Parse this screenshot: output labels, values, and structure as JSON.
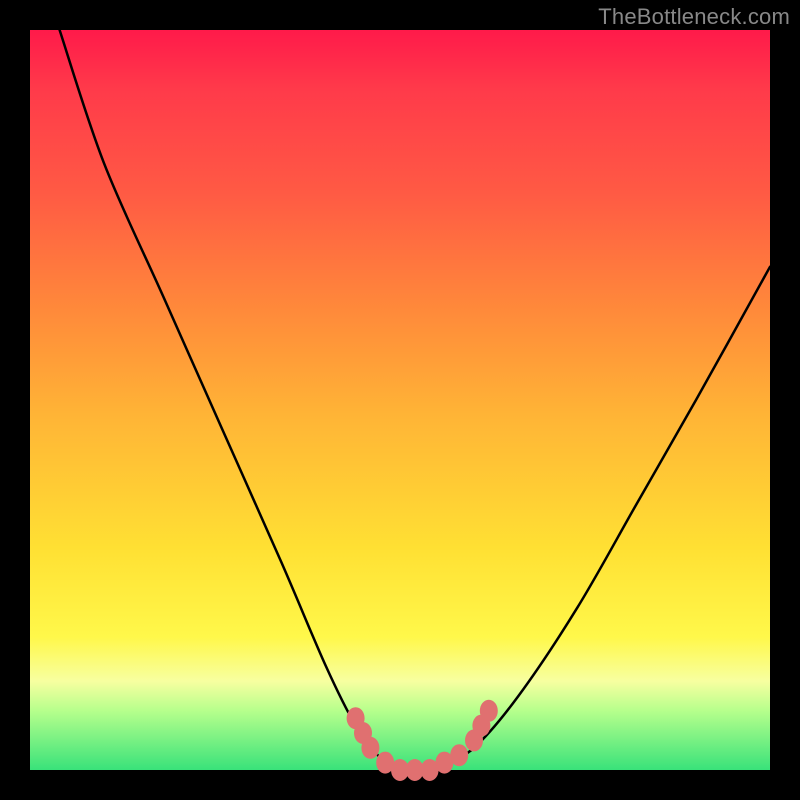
{
  "attribution": "TheBottleneck.com",
  "colors": {
    "frame": "#000000",
    "gradient_top": "#ff1a4a",
    "gradient_bottom": "#39e27a",
    "curve": "#000000",
    "marker": "#e07070"
  },
  "chart_data": {
    "type": "line",
    "title": "",
    "xlabel": "",
    "ylabel": "",
    "xlim": [
      0,
      100
    ],
    "ylim": [
      0,
      100
    ],
    "grid": false,
    "legend": false,
    "series": [
      {
        "name": "bottleneck-curve",
        "note": "V-shaped curve; y≈0 near the trough. Values estimated from pixel position (no axis ticks visible).",
        "x": [
          4,
          10,
          18,
          26,
          34,
          40,
          44,
          47,
          50,
          53,
          56,
          60,
          66,
          74,
          82,
          90,
          100
        ],
        "y": [
          100,
          82,
          64,
          46,
          28,
          14,
          6,
          2,
          0,
          0,
          1,
          3,
          10,
          22,
          36,
          50,
          68
        ]
      }
    ],
    "markers": {
      "name": "trough-markers",
      "note": "Pink dots clustered around the curve minimum; x/y in same 0–100 space.",
      "points": [
        {
          "x": 44,
          "y": 7
        },
        {
          "x": 45,
          "y": 5
        },
        {
          "x": 46,
          "y": 3
        },
        {
          "x": 48,
          "y": 1
        },
        {
          "x": 50,
          "y": 0
        },
        {
          "x": 52,
          "y": 0
        },
        {
          "x": 54,
          "y": 0
        },
        {
          "x": 56,
          "y": 1
        },
        {
          "x": 58,
          "y": 2
        },
        {
          "x": 60,
          "y": 4
        },
        {
          "x": 61,
          "y": 6
        },
        {
          "x": 62,
          "y": 8
        }
      ]
    }
  }
}
